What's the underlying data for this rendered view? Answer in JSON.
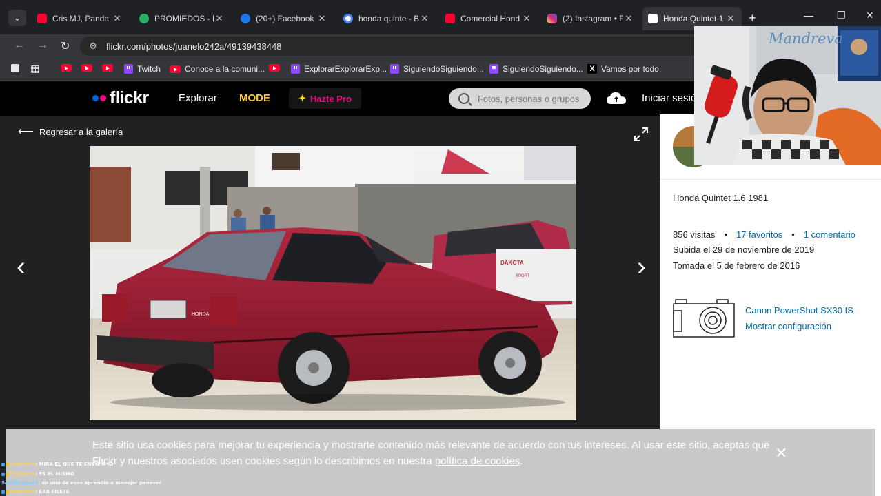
{
  "browser": {
    "tabs": [
      {
        "label": "Cris MJ, Panda B",
        "favicon": "youtube-icon",
        "color": "#ff0033"
      },
      {
        "label": "PROMIEDOS - Fú",
        "favicon": "soccer-ball-icon",
        "color": "#27ae60"
      },
      {
        "label": "(20+) Facebook",
        "favicon": "facebook-icon",
        "color": "#1877f2"
      },
      {
        "label": "honda quinte - B",
        "favicon": "google-icon",
        "color": "#4285f4"
      },
      {
        "label": "Comercial Hond",
        "favicon": "youtube-icon",
        "color": "#ff0033"
      },
      {
        "label": "(2) Instagram • F",
        "favicon": "instagram-icon",
        "color": "#e1306c"
      },
      {
        "label": "Honda Quintet 1",
        "favicon": "flickr-icon",
        "color": "#ff0084"
      }
    ],
    "url": "flickr.com/photos/juanelo242a/49139438448",
    "bookmarks": [
      {
        "label": "",
        "icon": "youtube-icon"
      },
      {
        "label": "",
        "icon": "youtube-icon"
      },
      {
        "label": "",
        "icon": "youtube-icon"
      },
      {
        "label": "Twitch",
        "icon": "twitch-icon"
      },
      {
        "label": "Conoce a la comuni...",
        "icon": "youtube-icon"
      },
      {
        "label": "",
        "icon": "youtube-icon"
      },
      {
        "label": "ExplorarExplorarExp...",
        "icon": "twitch-icon"
      },
      {
        "label": "SiguiendoSiguiendo...",
        "icon": "twitch-icon"
      },
      {
        "label": "SiguiendoSiguiendo...",
        "icon": "twitch-icon"
      },
      {
        "label": "Vamos por todo.",
        "icon": "x-icon"
      }
    ]
  },
  "flickr": {
    "logo": "flickr",
    "nav": {
      "explore": "Explorar",
      "mode": "MODE",
      "pro": "Hazte Pro"
    },
    "search_placeholder": "Fotos, personas o grupos",
    "signin": "Iniciar sesión",
    "back": "Regresar a la galería",
    "photo": {
      "title": "Honda Quintet 1.6 1981",
      "views": "856 visitas",
      "favorites": "17 favoritos",
      "comments": "1 comentario",
      "uploaded": "Subida el 29 de noviembre de 2019",
      "taken": "Tomada el 5 de febrero de 2016",
      "camera": "Canon PowerShot SX30 IS",
      "settings": "Mostrar configuración",
      "plate_brand": "HONDA",
      "truck_badge": "DAKOTA",
      "truck_model": "SPORT"
    },
    "cookie": {
      "text": "Este sitio usa cookies para mejorar tu experiencia y mostrarte contenido más relevante de acuerdo con tus intereses. Al usar este sitio, aceptas que Flickr y nuestros asociados usen cookies según lo describimos en nuestra",
      "link": "política de cookies",
      "end": "."
    }
  },
  "stream": {
    "channel": "Mandreva",
    "chat": [
      {
        "user": "Penever1",
        "msg": ": MIRA EL QUE TE ENVIE A IG"
      },
      {
        "user": "Penever1",
        "msg": ": ES EL MISMO"
      },
      {
        "user": "SolidSnake31",
        "msg": ": en uno de esos aprendio a manejar penever"
      },
      {
        "user": "Penever1",
        "msg": ": ERA FILETE"
      }
    ]
  }
}
